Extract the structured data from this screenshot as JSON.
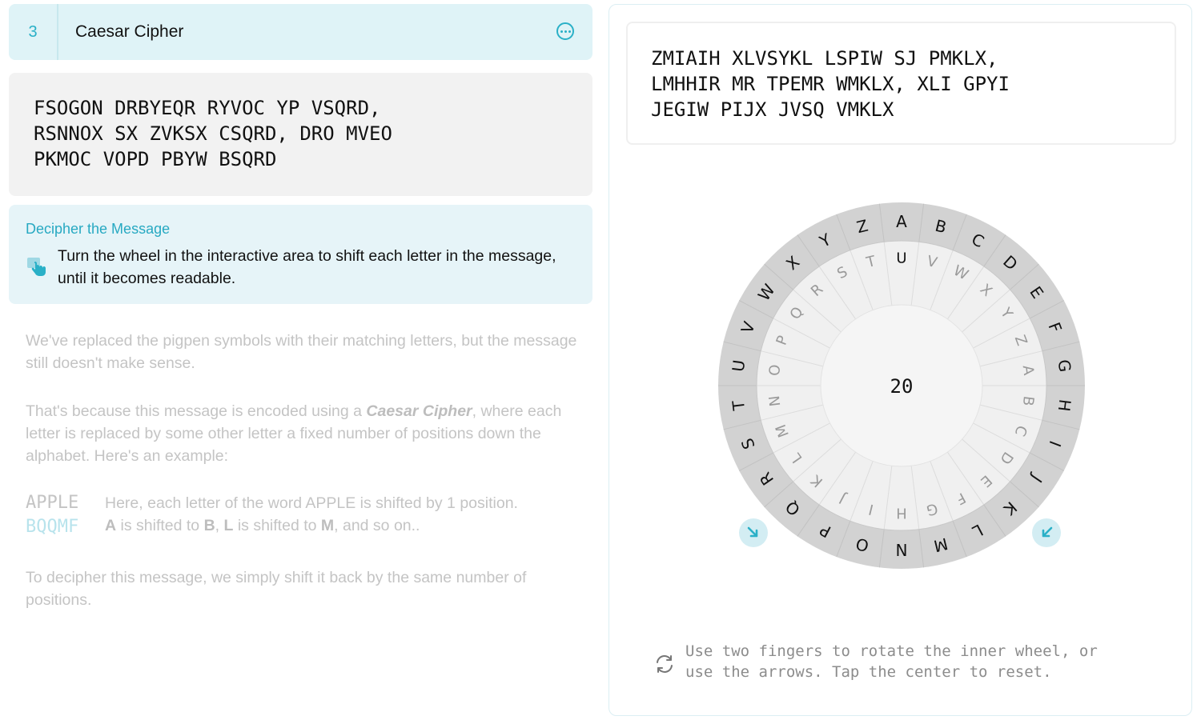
{
  "header": {
    "number": "3",
    "title": "Caesar Cipher",
    "more_icon": "ellipsis-circle-icon"
  },
  "cipher_lines": [
    "FSOGON DRBYEQR RYVOC YP VSQRD,",
    "RSNNOX SX ZVKSX CSQRD, DRO MVEO",
    "PKMOC VOPD PBYW BSQRD"
  ],
  "instructions": {
    "title": "Decipher the Message",
    "icon": "hand-tap-icon",
    "text": "Turn the wheel in the interactive area to shift each letter in the message, until it becomes readable."
  },
  "explanation": {
    "p1": "We've replaced the pigpen symbols with their matching letters, but the message still doesn't make sense.",
    "p2_before": "That's because this message is encoded using a ",
    "p2_em": "Caesar Cipher",
    "p2_after": ", where each letter is replaced by some other letter a fixed number of positions down the alphabet. Here's an example:",
    "example_word": "APPLE",
    "example_shifted": "BQQMF",
    "example_line1": "Here, each letter of the word APPLE is shifted by 1 position.",
    "example_line2_parts": [
      "A",
      " is shifted to ",
      "B",
      ", ",
      "L",
      " is shifted to ",
      "M",
      ", and so on.."
    ],
    "p3": "To decipher this message, we simply shift it back by the same number of positions."
  },
  "output_lines": [
    "ZMIAIH XLVSYKL LSPIW SJ PMKLX,",
    "LMHHIR MR TPEMR WMKLX, XLI GPYI",
    "JEGIW PIJX JVSQ VMKLX"
  ],
  "wheel": {
    "shift": "20",
    "outer_letters": [
      "A",
      "B",
      "C",
      "D",
      "E",
      "F",
      "G",
      "H",
      "I",
      "J",
      "K",
      "L",
      "M",
      "N",
      "O",
      "P",
      "Q",
      "R",
      "S",
      "T",
      "U",
      "V",
      "W",
      "X",
      "Y",
      "Z"
    ],
    "inner_letters": [
      "U",
      "V",
      "W",
      "X",
      "Y",
      "Z",
      "A",
      "B",
      "C",
      "D",
      "E",
      "F",
      "G",
      "H",
      "I",
      "J",
      "K",
      "L",
      "M",
      "N",
      "O",
      "P",
      "Q",
      "R",
      "S",
      "T"
    ],
    "outer_color": "#d2d2d2",
    "inner_color": "#f0f0f0",
    "center_color": "#f5f5f5",
    "accent": "#2ab0c7",
    "rotate_left_icon": "arrow-down-right-icon",
    "rotate_right_icon": "arrow-down-left-icon"
  },
  "hint": {
    "icon": "rotate-icon",
    "line1": "Use two fingers to rotate the inner wheel, or",
    "line2": "use the arrows. Tap the center to reset."
  }
}
